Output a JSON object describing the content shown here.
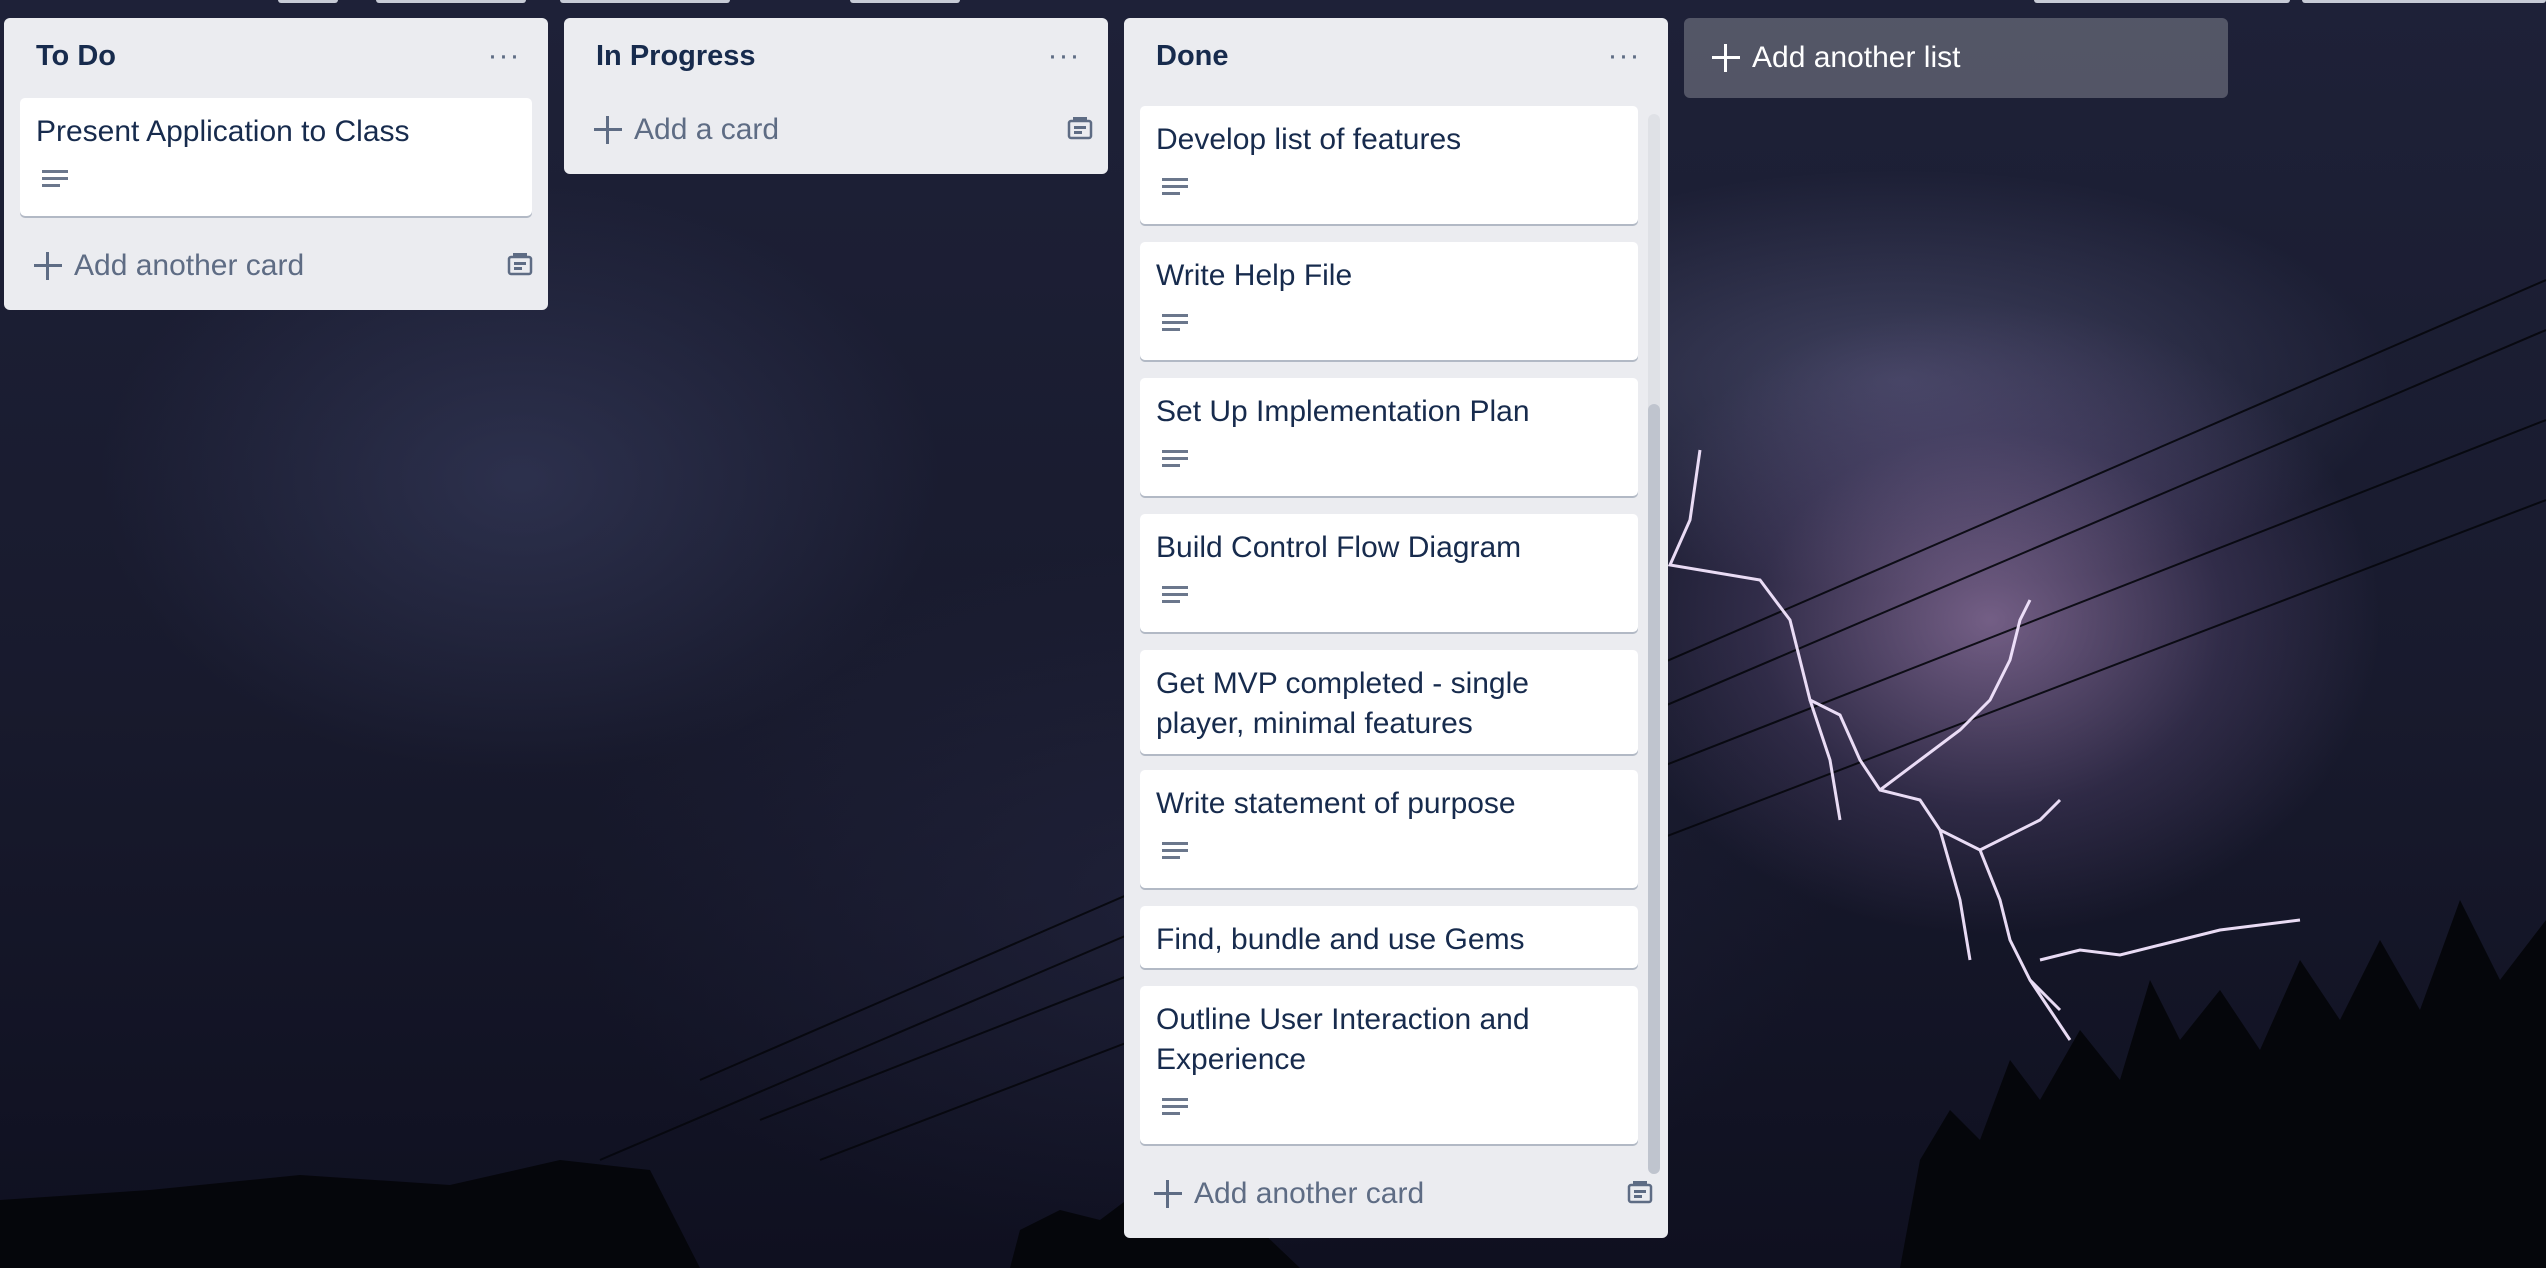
{
  "lists": [
    {
      "title": "To Do",
      "cards": [
        {
          "title": "Present Application to Class",
          "has_description": true
        }
      ],
      "add_label": "Add another card"
    },
    {
      "title": "In Progress",
      "cards": [],
      "add_label": "Add a card"
    },
    {
      "title": "Done",
      "cards": [
        {
          "title": "Develop list of features",
          "has_description": true
        },
        {
          "title": "Write Help File",
          "has_description": true
        },
        {
          "title": "Set Up Implementation Plan",
          "has_description": true
        },
        {
          "title": "Build Control Flow Diagram",
          "has_description": true
        },
        {
          "title": "Get MVP completed - single player, minimal features",
          "has_description": false
        },
        {
          "title": "Write statement of purpose",
          "has_description": true
        },
        {
          "title": "Find, bundle and use Gems",
          "has_description": false
        },
        {
          "title": "Outline User Interaction and Experience",
          "has_description": true
        }
      ],
      "add_label": "Add another card"
    }
  ],
  "add_list_label": "Add another list",
  "icons": {
    "list_menu": "more-horizontal-icon",
    "description": "description-icon",
    "add": "plus-icon",
    "template": "card-template-icon"
  },
  "colors": {
    "list_bg": "#ebecf0",
    "card_bg": "#ffffff",
    "text": "#172b4d",
    "muted": "#5e6c84"
  }
}
